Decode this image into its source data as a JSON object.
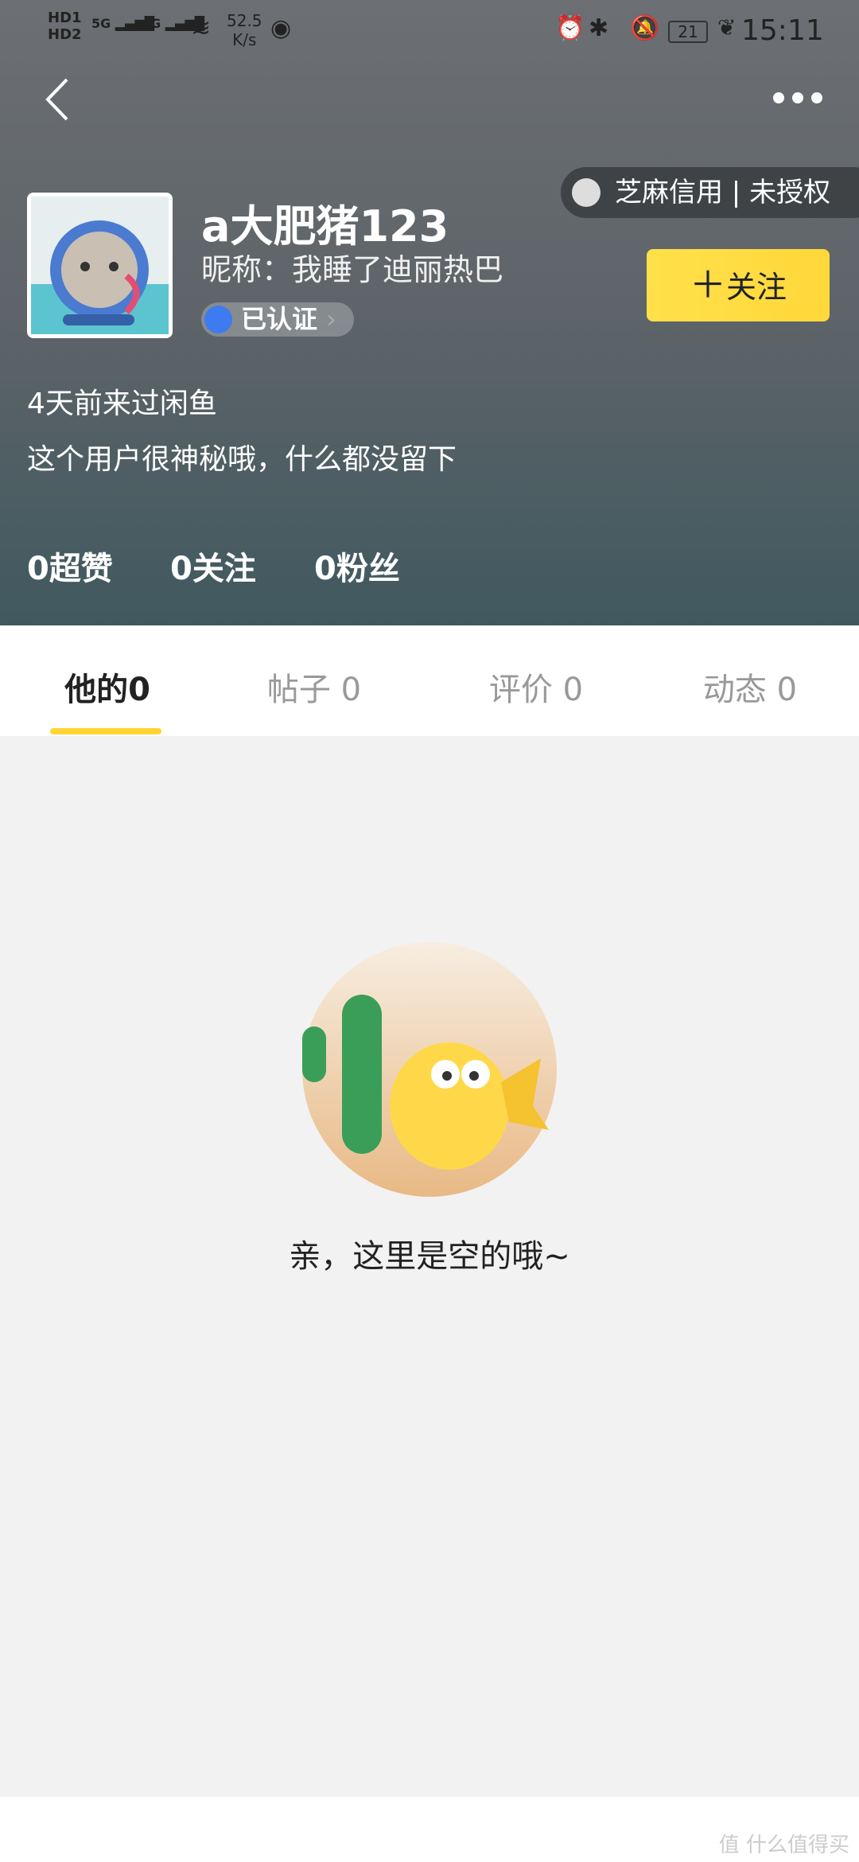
{
  "status_bar": {
    "network_speed": "52.5",
    "network_unit": "K/s",
    "signal_1": "5G",
    "signal_2": "4G",
    "battery": "21",
    "time": "15:11"
  },
  "nav": {
    "back_icon": "chevron-left-icon",
    "more_icon": "more-dots-icon"
  },
  "profile": {
    "username": "a大肥猪123",
    "nickname": "昵称：我睡了迪丽热巴",
    "verified_label": "已认证",
    "credit_label": "芝麻信用 | 未授权",
    "follow_label": "关注",
    "last_seen": "4天前来过闲鱼",
    "bio": "这个用户很神秘哦，什么都没留下",
    "stats": [
      {
        "label": "0超赞"
      },
      {
        "label": "0关注"
      },
      {
        "label": "0粉丝"
      }
    ]
  },
  "tabs": [
    {
      "label": "他的0",
      "active": true
    },
    {
      "label": "帖子 0"
    },
    {
      "label": "评价 0"
    },
    {
      "label": "动态 0"
    }
  ],
  "empty_state": {
    "message": "亲，这里是空的哦~"
  },
  "watermark": "值 什么值得买",
  "colors": {
    "accent": "#ffda44",
    "tab_indicator": "#ffd633"
  }
}
